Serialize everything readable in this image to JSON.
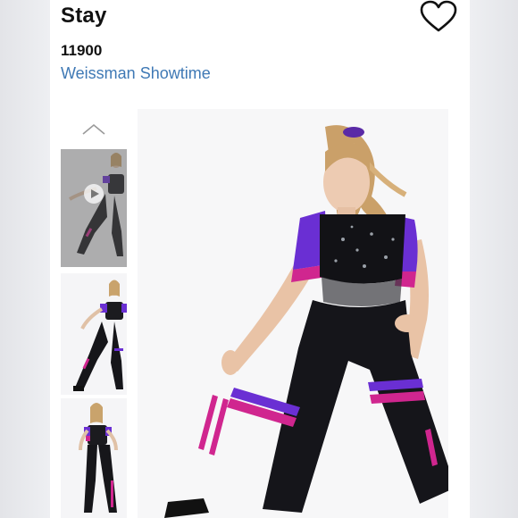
{
  "product": {
    "title": "Stay",
    "sku": "11900",
    "brand": "Weissman Showtime"
  },
  "icons": {
    "favorite": "heart-outline-icon",
    "gallery_up": "chevron-up-icon",
    "video_play": "play-icon"
  },
  "gallery": {
    "thumbnails": [
      {
        "kind": "video",
        "view": "front"
      },
      {
        "kind": "image",
        "view": "front"
      },
      {
        "kind": "image",
        "view": "back"
      }
    ],
    "selected_index": 0
  },
  "colors": {
    "brand_link": "#3f79b5",
    "costume_purple": "#6a2fd3",
    "costume_pink": "#d0268f"
  }
}
